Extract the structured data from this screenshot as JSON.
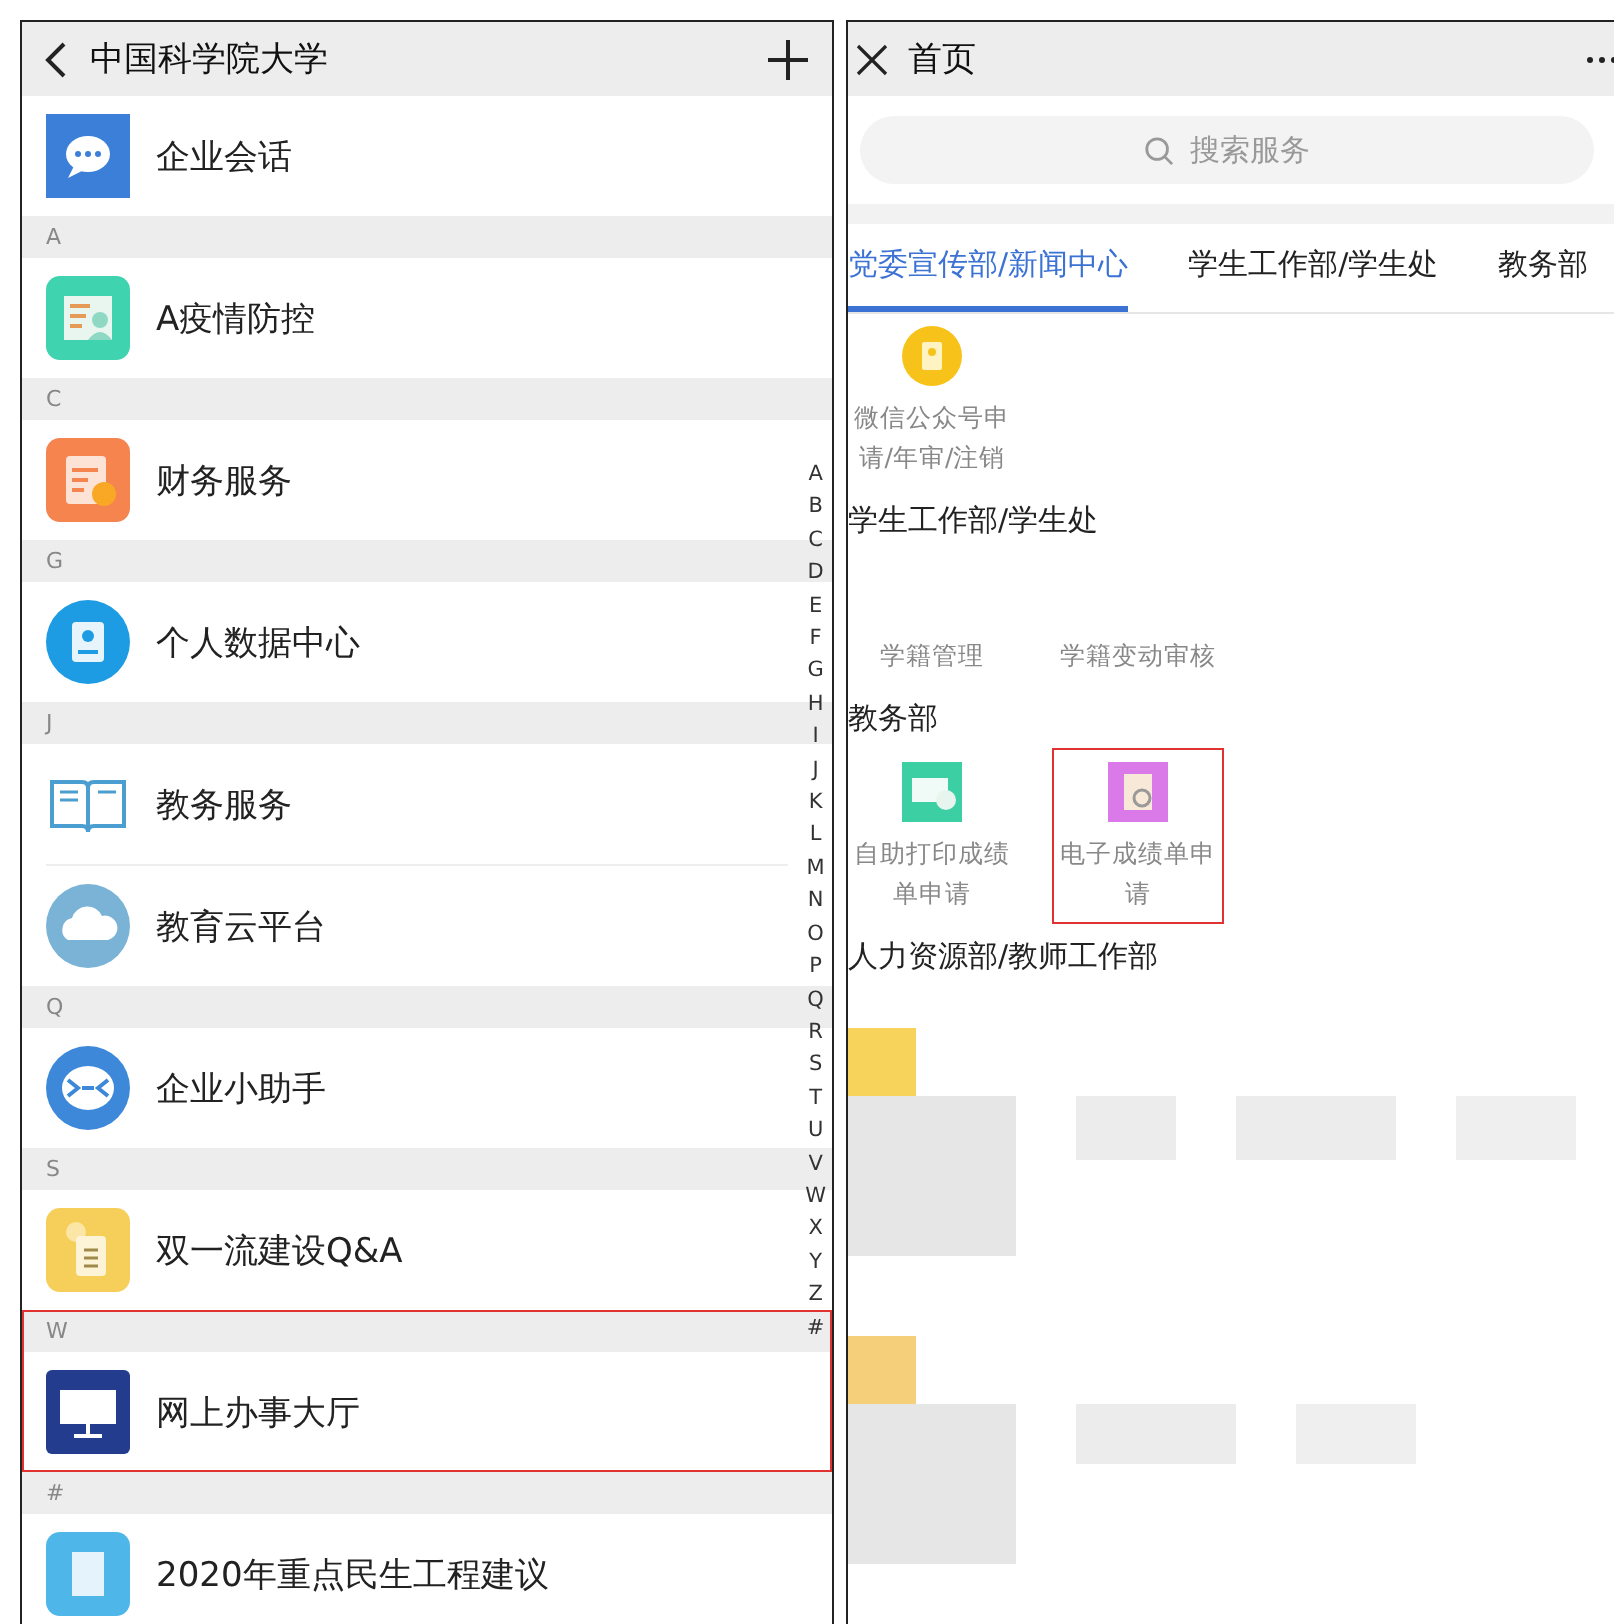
{
  "left": {
    "header": {
      "title": "中国科学院大学"
    },
    "sections": [
      {
        "highlighted": false,
        "apps": [
          {
            "label": "企业会话"
          }
        ]
      },
      {
        "letter": "A",
        "highlighted": false,
        "apps": [
          {
            "label": "A疫情防控"
          }
        ]
      },
      {
        "letter": "C",
        "highlighted": false,
        "apps": [
          {
            "label": "财务服务"
          }
        ]
      },
      {
        "letter": "G",
        "highlighted": false,
        "apps": [
          {
            "label": "个人数据中心"
          }
        ]
      },
      {
        "letter": "J",
        "highlighted": false,
        "apps": [
          {
            "label": "教务服务"
          },
          {
            "label": "教育云平台"
          }
        ]
      },
      {
        "letter": "Q",
        "highlighted": false,
        "apps": [
          {
            "label": "企业小助手"
          }
        ]
      },
      {
        "letter": "S",
        "highlighted": false,
        "apps": [
          {
            "label": "双一流建设Q&A"
          }
        ]
      },
      {
        "letter": "W",
        "highlighted": true,
        "apps": [
          {
            "label": "网上办事大厅"
          }
        ]
      },
      {
        "letter": "#",
        "highlighted": false,
        "apps": [
          {
            "label": "2020年重点民生工程建议"
          }
        ]
      }
    ],
    "index": [
      "A",
      "B",
      "C",
      "D",
      "E",
      "F",
      "G",
      "H",
      "I",
      "J",
      "K",
      "L",
      "M",
      "N",
      "O",
      "P",
      "Q",
      "R",
      "S",
      "T",
      "U",
      "V",
      "W",
      "X",
      "Y",
      "Z",
      "#"
    ]
  },
  "right": {
    "header": {
      "title": "首页"
    },
    "search": {
      "placeholder": "搜索服务"
    },
    "tabs": [
      {
        "label": "党委宣传部/新闻中心",
        "selected": true
      },
      {
        "label": "学生工作部/学生处",
        "selected": false
      },
      {
        "label": "教务部",
        "selected": false
      }
    ],
    "departments": [
      {
        "services": [
          {
            "kind": "icon",
            "label": "微信公众号申请/年审/注销",
            "highlighted": false
          }
        ]
      },
      {
        "title": "学生工作部/学生处",
        "services": [
          {
            "kind": "plain",
            "label": "学籍管理",
            "highlighted": false
          },
          {
            "kind": "plain",
            "label": "学籍变动审核",
            "highlighted": false
          }
        ]
      },
      {
        "title": "教务部",
        "services": [
          {
            "kind": "icon",
            "label": "自助打印成绩单申请",
            "highlighted": false
          },
          {
            "kind": "icon",
            "label": "电子成绩单申请",
            "highlighted": true
          }
        ]
      },
      {
        "title": "人力资源部/教师工作部"
      }
    ]
  }
}
